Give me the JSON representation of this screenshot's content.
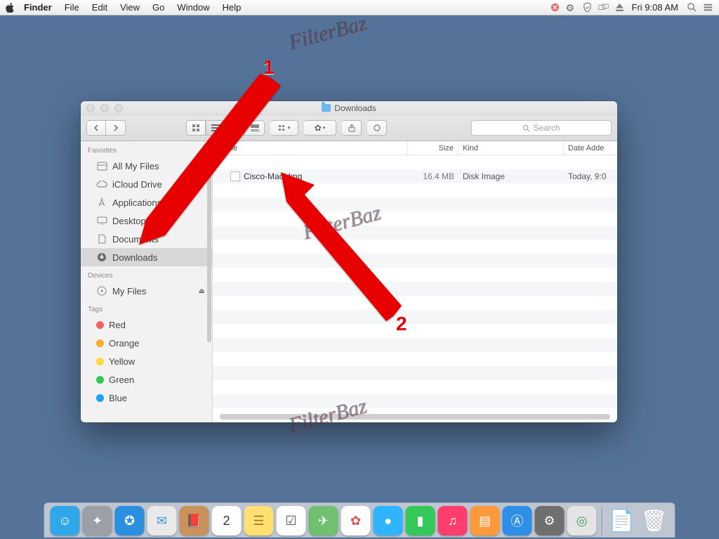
{
  "menubar": {
    "app": "Finder",
    "items": [
      "File",
      "Edit",
      "View",
      "Go",
      "Window",
      "Help"
    ],
    "clock": "Fri 9:08 AM"
  },
  "window": {
    "title": "Downloads",
    "search_placeholder": "Search",
    "columns": {
      "name": "Name",
      "size": "Size",
      "kind": "Kind",
      "date": "Date Adde"
    },
    "sidebar": {
      "favorites_label": "Favorites",
      "favorites": [
        {
          "label": "All My Files",
          "icon": "all-my-files"
        },
        {
          "label": "iCloud Drive",
          "icon": "icloud"
        },
        {
          "label": "Applications",
          "icon": "applications"
        },
        {
          "label": "Desktop",
          "icon": "desktop"
        },
        {
          "label": "Documents",
          "icon": "documents"
        },
        {
          "label": "Downloads",
          "icon": "downloads",
          "selected": true
        }
      ],
      "devices_label": "Devices",
      "devices": [
        {
          "label": "My Files",
          "icon": "disc",
          "eject": true
        }
      ],
      "tags_label": "Tags",
      "tags": [
        {
          "label": "Red",
          "color": "#fc605c"
        },
        {
          "label": "Orange",
          "color": "#fdad2a"
        },
        {
          "label": "Yellow",
          "color": "#fdd93a"
        },
        {
          "label": "Green",
          "color": "#34c84a"
        },
        {
          "label": "Blue",
          "color": "#1aa2ff"
        }
      ]
    },
    "files": [
      {
        "name": "Cisco-Mac.dmg",
        "size": "16.4 MB",
        "kind": "Disk Image",
        "date": "Today, 9:0"
      }
    ]
  },
  "dock": {
    "apps": [
      {
        "name": "finder",
        "bg": "#2fa7e8",
        "glyph": "☺"
      },
      {
        "name": "launchpad",
        "bg": "#9aa0a6",
        "glyph": "✦"
      },
      {
        "name": "safari",
        "bg": "#2b8fe0",
        "glyph": "✪"
      },
      {
        "name": "mail",
        "bg": "#e9e9e9",
        "glyph": "✉",
        "fg": "#4a90e2"
      },
      {
        "name": "contacts",
        "bg": "#c9925a",
        "glyph": "📕"
      },
      {
        "name": "calendar",
        "bg": "#ffffff",
        "glyph": "2",
        "fg": "#333"
      },
      {
        "name": "notes",
        "bg": "#ffe071",
        "glyph": "☰",
        "fg": "#a07a20"
      },
      {
        "name": "reminders",
        "bg": "#ffffff",
        "glyph": "☑",
        "fg": "#555"
      },
      {
        "name": "maps",
        "bg": "#6fc06f",
        "glyph": "✈"
      },
      {
        "name": "photos",
        "bg": "#ffffff",
        "glyph": "✿",
        "fg": "#e05050"
      },
      {
        "name": "messages",
        "bg": "#2fb5ff",
        "glyph": "●"
      },
      {
        "name": "facetime",
        "bg": "#34c759",
        "glyph": "▮"
      },
      {
        "name": "itunes",
        "bg": "#ff3e6c",
        "glyph": "♫"
      },
      {
        "name": "ibooks",
        "bg": "#ff9a3c",
        "glyph": "▤"
      },
      {
        "name": "appstore",
        "bg": "#2f8fe6",
        "glyph": "Ⓐ"
      },
      {
        "name": "preferences",
        "bg": "#6f6f6f",
        "glyph": "⚙"
      },
      {
        "name": "cisco",
        "bg": "#e4e4e4",
        "glyph": "◎",
        "fg": "#3aa35a"
      }
    ],
    "right": [
      {
        "name": "document",
        "glyph": "📄"
      },
      {
        "name": "trash",
        "glyph": "🗑"
      }
    ]
  },
  "annotations": {
    "one": "1",
    "two": "2"
  },
  "watermark": "FilterBaz"
}
